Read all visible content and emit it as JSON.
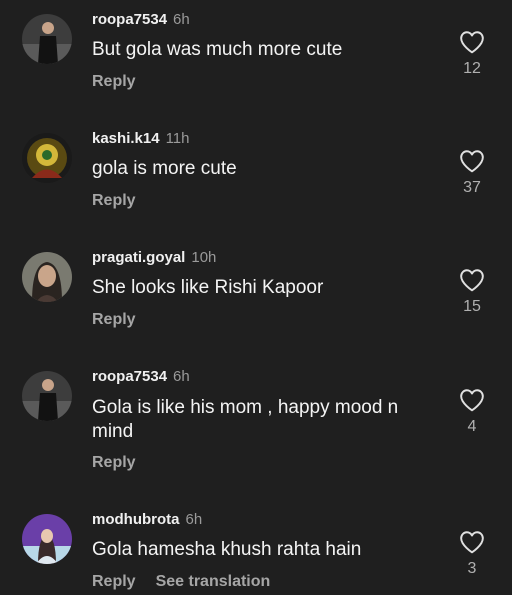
{
  "comments": [
    {
      "username": "roopa7534",
      "time": "6h",
      "text": "But gola was much more cute",
      "reply_label": "Reply",
      "like_count": "12",
      "avatar_icon": "avatar-woman-dark-dress",
      "avatar_colors": [
        "#3d3d3d",
        "#121212",
        "#8a8a8a"
      ]
    },
    {
      "username": "kashi.k14",
      "time": "11h",
      "text": "gola is more cute",
      "reply_label": "Reply",
      "like_count": "37",
      "avatar_icon": "avatar-deity-yellow",
      "avatar_colors": [
        "#5a4a12",
        "#d4b83a",
        "#1a1a1a"
      ]
    },
    {
      "username": "pragati.goyal",
      "time": "10h",
      "text": "She looks like Rishi Kapoor",
      "reply_label": "Reply",
      "like_count": "15",
      "avatar_icon": "avatar-woman-portrait",
      "avatar_colors": [
        "#7a7a70",
        "#c9a58a",
        "#2a2420"
      ]
    },
    {
      "username": "roopa7534",
      "time": "6h",
      "text": "Gola is like his mom , happy mood n mind",
      "reply_label": "Reply",
      "like_count": "4",
      "avatar_icon": "avatar-woman-dark-dress",
      "avatar_colors": [
        "#3d3d3d",
        "#121212",
        "#8a8a8a"
      ]
    },
    {
      "username": "modhubrota",
      "time": "6h",
      "text": "Gola hamesha khush rahta hain",
      "reply_label": "Reply",
      "see_translation_label": "See translation",
      "like_count": "3",
      "avatar_icon": "avatar-woman-purple",
      "avatar_colors": [
        "#6a3fa8",
        "#e8c8b0",
        "#b8d8e8"
      ]
    }
  ],
  "theme": {
    "background": "#1f1f1f",
    "text": "#f4f4f4",
    "muted": "#a6a6a6",
    "heart_outline": "#e0e0e0"
  }
}
